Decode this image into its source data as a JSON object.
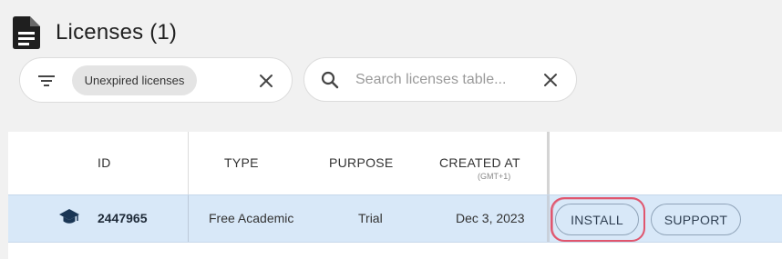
{
  "page": {
    "title": "Licenses (1)"
  },
  "filter": {
    "chip_label": "Unexpired licenses"
  },
  "search": {
    "placeholder": "Search licenses table..."
  },
  "table": {
    "columns": [
      {
        "label": "ID"
      },
      {
        "label": "TYPE"
      },
      {
        "label": "PURPOSE"
      },
      {
        "label": "CREATED AT",
        "sublabel": "(GMT+1)"
      }
    ],
    "rows": [
      {
        "icon": "graduation-cap-icon",
        "id": "2447965",
        "type": "Free Academic",
        "purpose": "Trial",
        "created_at": "Dec 3, 2023",
        "actions": {
          "install": "INSTALL",
          "support": "SUPPORT"
        }
      }
    ]
  },
  "colors": {
    "row_highlight": "#d8e8f8",
    "annotation_red": "#e0566e",
    "accent_icon": "#1a3655"
  }
}
